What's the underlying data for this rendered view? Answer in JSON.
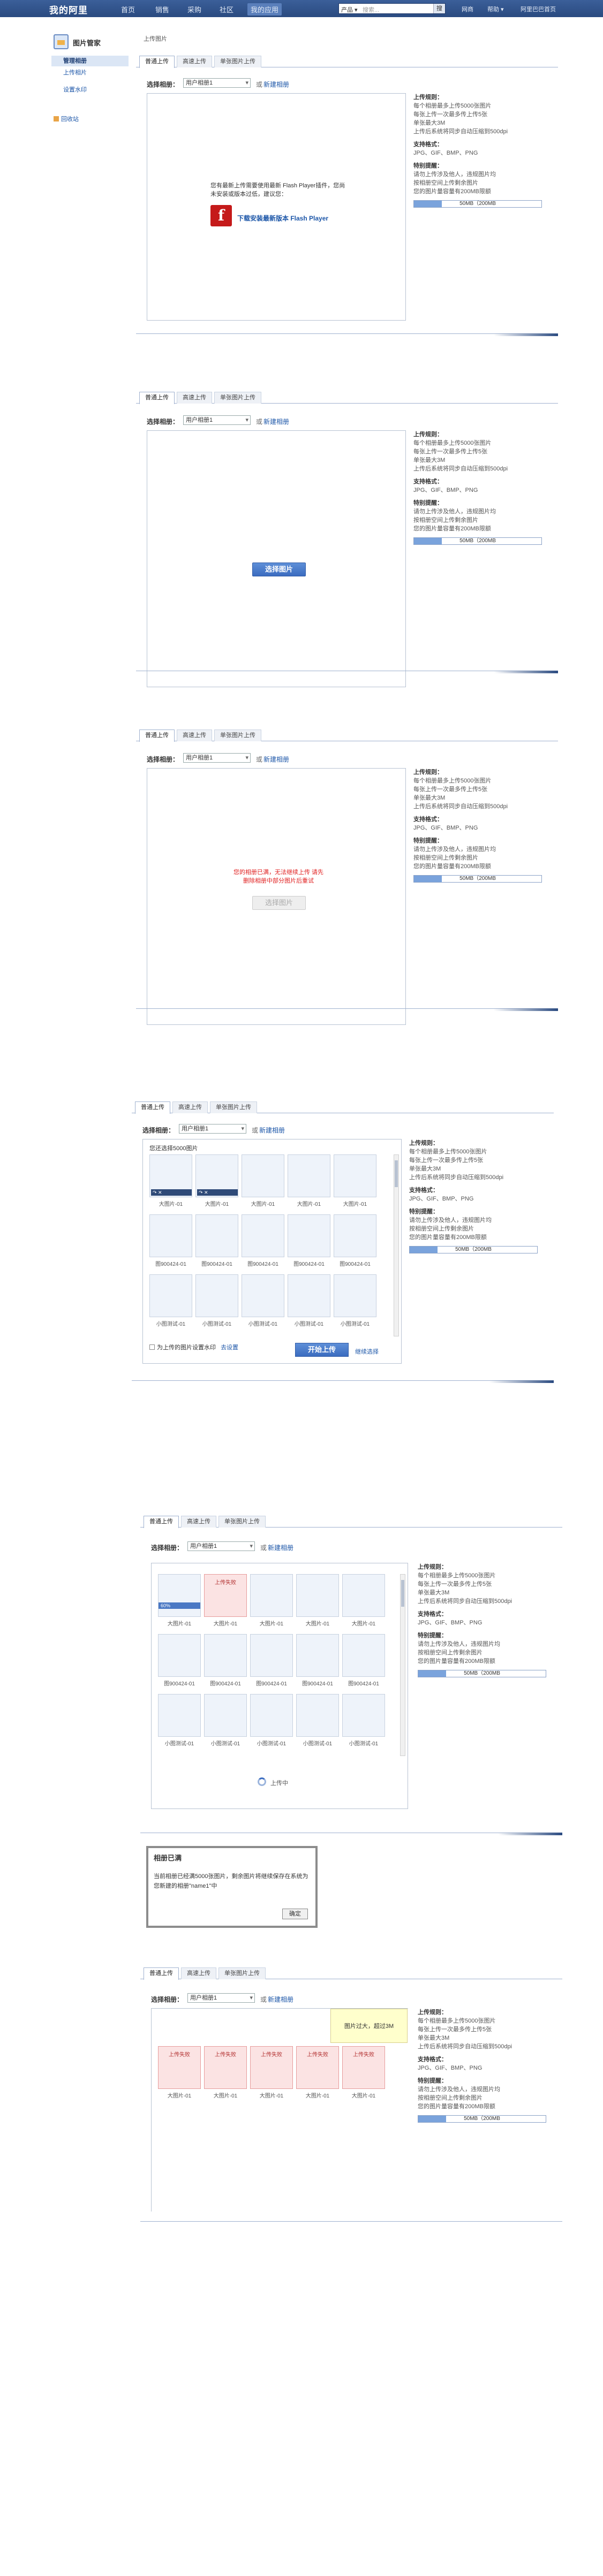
{
  "nav": {
    "logo": "我的阿里",
    "items": [
      "首页",
      "销售",
      "采购",
      "社区",
      "我的应用"
    ],
    "search_select": "产品 ▾",
    "search_placeholder": "搜索...",
    "search_button": "搜",
    "right": [
      "网商",
      "帮助 ▾",
      "阿里巴巴首页"
    ]
  },
  "sidebar": {
    "title": "图片管家",
    "items": [
      "管理相册",
      "上传相片",
      "设置水印"
    ],
    "extra": "回收站"
  },
  "breadcrumb": "上传图片",
  "tabs": [
    "普通上传",
    "高速上传",
    "单张图片上传"
  ],
  "toolbar": {
    "label": "选择相册：",
    "select": "用户相册1",
    "or": "或",
    "new_album": "新建相册"
  },
  "info": {
    "rule_title": "上传规则：",
    "rules": [
      "每个相册最多上传5000张图片",
      "每张上传一次最多传上传5张",
      "单张最大3M",
      "上传后系统将同步自动压缩到500dpi"
    ],
    "format_title": "支持格式：",
    "formats": "JPG、GIF、BMP、PNG",
    "tip_title": "特别提醒：",
    "tips": [
      "请勿上传涉及他人，违规图片均",
      "按相册空间上传剩余图片",
      "您的图片量容量有200MB限额"
    ],
    "capacity": "50MB（200MB",
    "capacity_fraction": 0.22
  },
  "flash": {
    "message": "您有最新上传需要使用最新 Flash Player插件，您尚未安装或版本过低，建议您：",
    "link": "下载安装最新版本 Flash Player"
  },
  "select_button": "选择图片",
  "warning": "您的相册已满，无法继续上传 请先删除相册中部分图片后重试",
  "grid": {
    "count": "您还选择5000图片",
    "row1": [
      "大图片-01",
      "大图片-01",
      "大图片-01",
      "大图片-01",
      "大图片-01"
    ],
    "row2": [
      "图900424-01",
      "图900424-01",
      "图900424-01",
      "图900424-01",
      "图900424-01"
    ],
    "row3": [
      "小图测试-01",
      "小图测试-01",
      "小图测试-01",
      "小图测试-01",
      "小图测试-01"
    ],
    "progress": "60%",
    "error_tag": "上传失败",
    "auto_set": "为上传的图片设置水印",
    "set_link": "去设置",
    "upload": "开始上传",
    "continue": "继续选择",
    "uploading": "上传中"
  },
  "dialog": {
    "title": "相册已满",
    "body": "当前相册已经满5000张图片，剩余图片将继续保存在系统为您新建的相册\"name1\"中",
    "ok": "确定"
  },
  "tooltip": "图片过大，超过3M"
}
